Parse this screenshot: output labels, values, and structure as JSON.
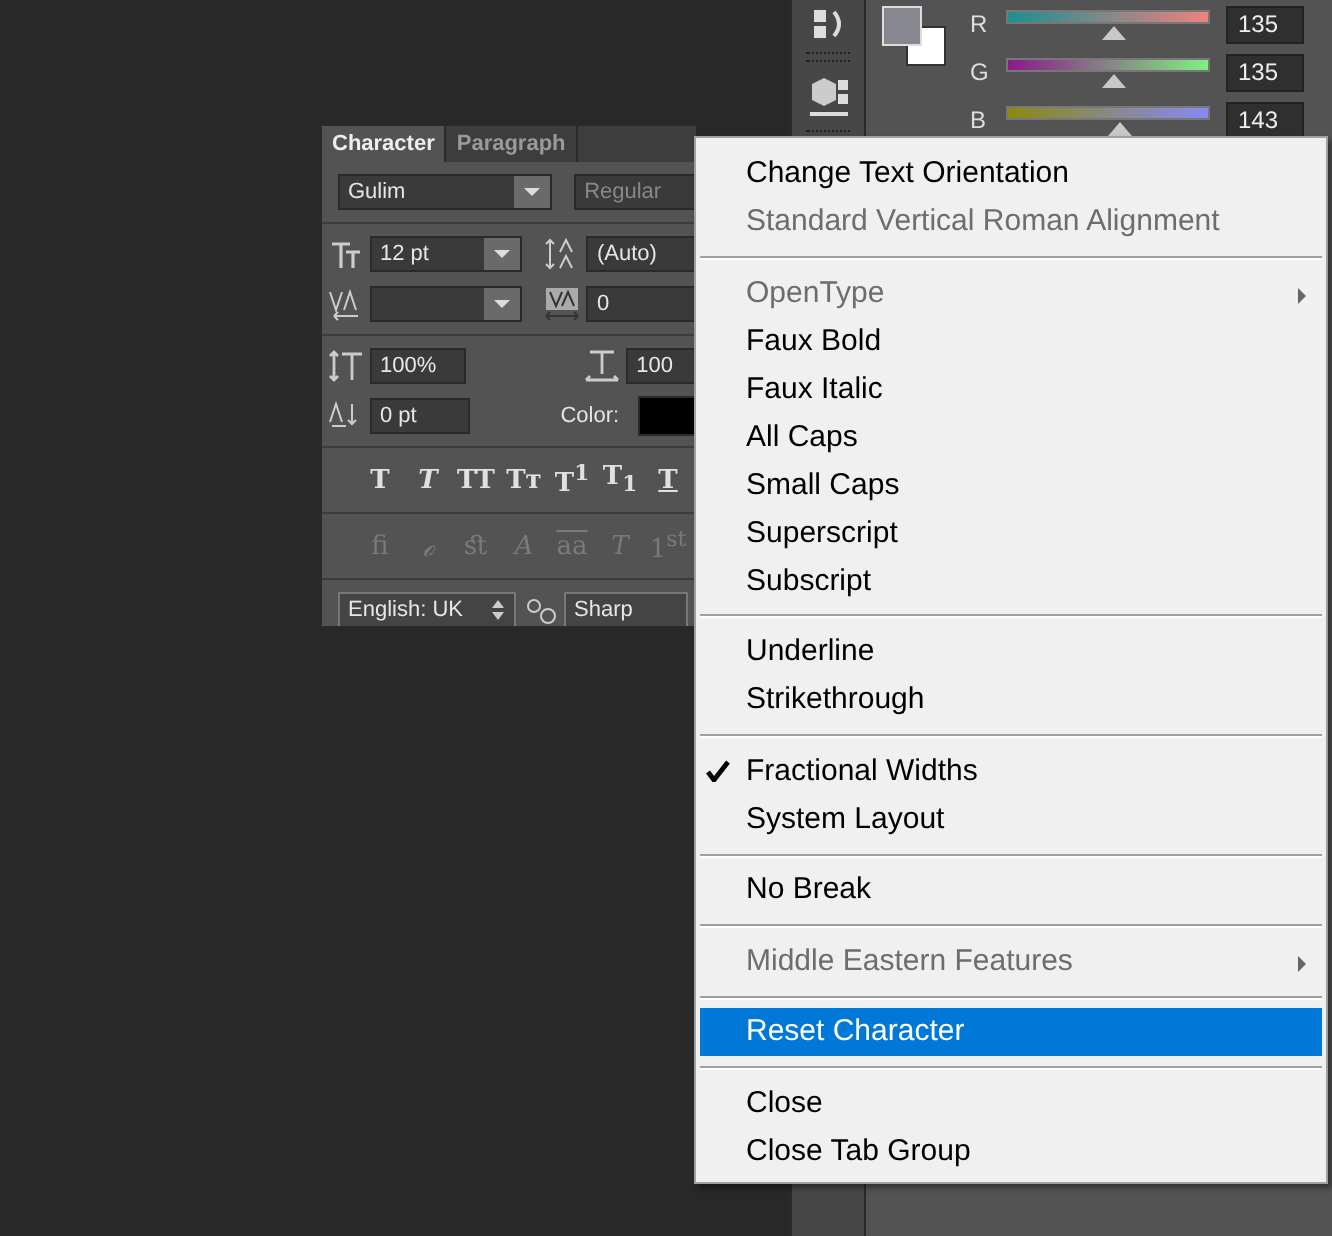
{
  "color_panel": {
    "channels": [
      {
        "label": "R",
        "level": 0.53,
        "value": "135"
      },
      {
        "label": "G",
        "level": 0.53,
        "value": "135"
      },
      {
        "label": "B",
        "level": 0.56,
        "value": "143"
      }
    ]
  },
  "character_panel": {
    "tabs": [
      {
        "label": "Character",
        "selected": true
      },
      {
        "label": "Paragraph",
        "selected": false
      }
    ],
    "font_family": "Gulim",
    "font_style": "Regular",
    "font_size": "12 pt",
    "leading": "(Auto)",
    "tracking": "0",
    "vertical_scale": "100%",
    "horizontal_scale": "100",
    "baseline_shift": "0 pt",
    "color_label": "Color:",
    "style_buttons": [
      {
        "label": "T",
        "kind": "plain"
      },
      {
        "label": "T",
        "kind": "italic"
      },
      {
        "label": "TT",
        "kind": "plain"
      },
      {
        "label": "Tᴛ",
        "kind": "plain"
      },
      {
        "label": "T$^{1}$",
        "kind": "plain"
      },
      {
        "label": "T$_{1}$",
        "kind": "plain"
      },
      {
        "label": "T",
        "kind": "underline"
      }
    ],
    "opentype_disabled": true,
    "opentype_buttons": [
      {
        "label": "ﬁ",
        "kind": "plain"
      },
      {
        "label": "ℴ",
        "kind": "italic"
      },
      {
        "label": "ﬆ",
        "kind": "plain"
      },
      {
        "label": "A",
        "kind": "italic"
      },
      {
        "label": "aa",
        "kind": "overline"
      },
      {
        "label": "T",
        "kind": "italic"
      },
      {
        "label": "1$^{st}$",
        "kind": "plain"
      }
    ],
    "language": "English: UK",
    "antialiasing": "Sharp"
  },
  "menu": {
    "items": [
      {
        "kind": "item",
        "label": "Change Text Orientation",
        "disabled": false,
        "checked": false,
        "selected": false,
        "submenu": false
      },
      {
        "kind": "item",
        "label": "Standard Vertical Roman Alignment",
        "disabled": true,
        "checked": false,
        "selected": false,
        "submenu": false
      },
      {
        "kind": "separator"
      },
      {
        "kind": "item",
        "label": "OpenType",
        "disabled": true,
        "checked": false,
        "selected": false,
        "submenu": true
      },
      {
        "kind": "item",
        "label": "Faux Bold",
        "disabled": false,
        "checked": false,
        "selected": false,
        "submenu": false
      },
      {
        "kind": "item",
        "label": "Faux Italic",
        "disabled": false,
        "checked": false,
        "selected": false,
        "submenu": false
      },
      {
        "kind": "item",
        "label": "All Caps",
        "disabled": false,
        "checked": false,
        "selected": false,
        "submenu": false
      },
      {
        "kind": "item",
        "label": "Small Caps",
        "disabled": false,
        "checked": false,
        "selected": false,
        "submenu": false
      },
      {
        "kind": "item",
        "label": "Superscript",
        "disabled": false,
        "checked": false,
        "selected": false,
        "submenu": false
      },
      {
        "kind": "item",
        "label": "Subscript",
        "disabled": false,
        "checked": false,
        "selected": false,
        "submenu": false
      },
      {
        "kind": "separator"
      },
      {
        "kind": "item",
        "label": "Underline",
        "disabled": false,
        "checked": false,
        "selected": false,
        "submenu": false
      },
      {
        "kind": "item",
        "label": "Strikethrough",
        "disabled": false,
        "checked": false,
        "selected": false,
        "submenu": false
      },
      {
        "kind": "separator"
      },
      {
        "kind": "item",
        "label": "Fractional Widths",
        "disabled": false,
        "checked": true,
        "selected": false,
        "submenu": false
      },
      {
        "kind": "item",
        "label": "System Layout",
        "disabled": false,
        "checked": false,
        "selected": false,
        "submenu": false
      },
      {
        "kind": "separator"
      },
      {
        "kind": "item",
        "label": "No Break",
        "disabled": false,
        "checked": false,
        "selected": false,
        "submenu": false
      },
      {
        "kind": "separator"
      },
      {
        "kind": "item",
        "label": "Middle Eastern Features",
        "disabled": true,
        "checked": false,
        "selected": false,
        "submenu": true
      },
      {
        "kind": "separator"
      },
      {
        "kind": "item",
        "label": "Reset Character",
        "disabled": false,
        "checked": false,
        "selected": true,
        "submenu": false
      },
      {
        "kind": "separator"
      },
      {
        "kind": "item",
        "label": "Close",
        "disabled": false,
        "checked": false,
        "selected": false,
        "submenu": false
      },
      {
        "kind": "item",
        "label": "Close Tab Group",
        "disabled": false,
        "checked": false,
        "selected": false,
        "submenu": false
      }
    ]
  }
}
